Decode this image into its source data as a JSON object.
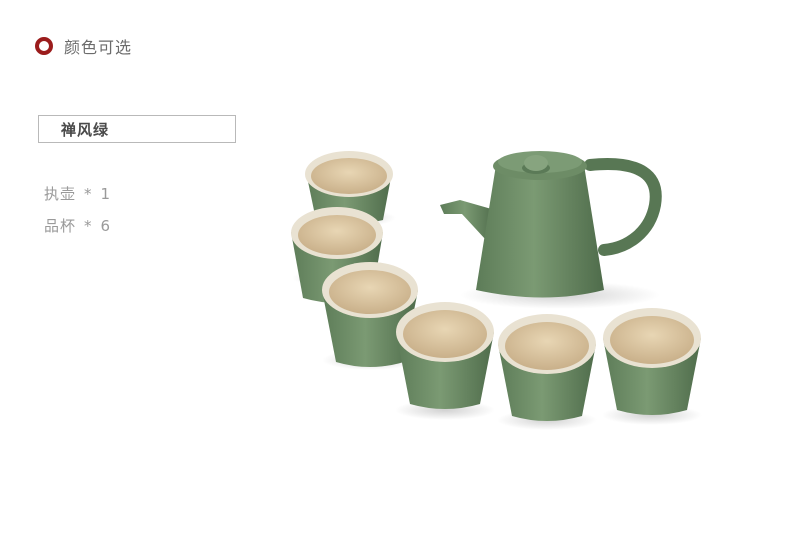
{
  "header": {
    "title": "颜色可选"
  },
  "variant": {
    "name": "禅风绿"
  },
  "specs": [
    {
      "label": "执壶",
      "sep": "*",
      "qty": "1"
    },
    {
      "label": "品杯",
      "sep": "*",
      "qty": "6"
    }
  ],
  "colors": {
    "accent_ring": "#9b1c1c",
    "glaze_green": "#6e8f68",
    "interior_cream": "#d9c4a0"
  }
}
